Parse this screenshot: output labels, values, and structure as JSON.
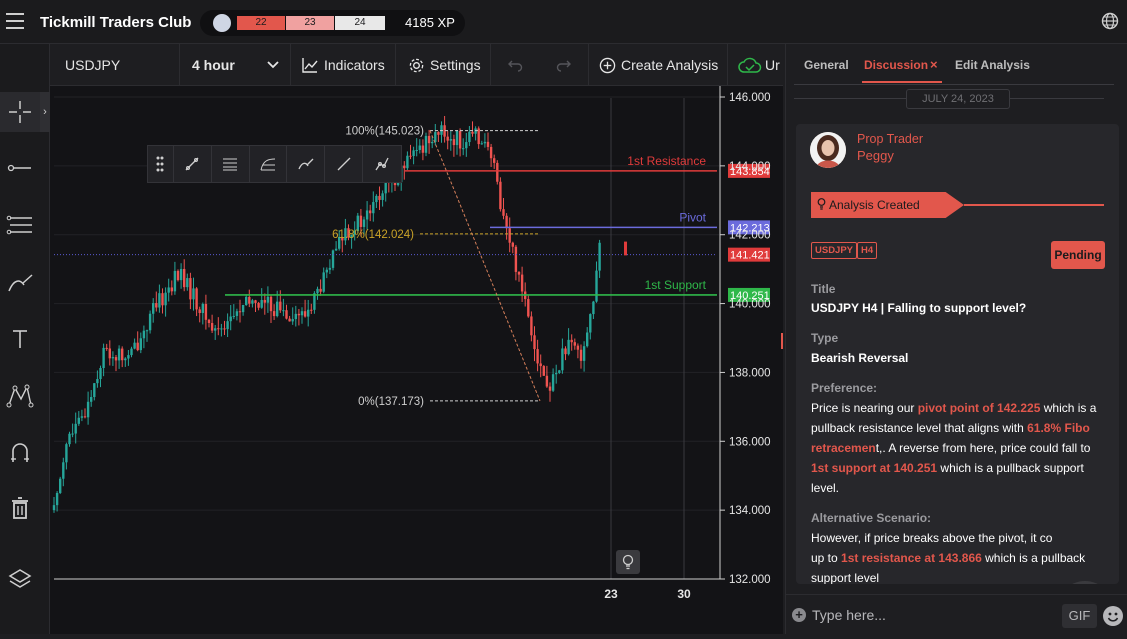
{
  "app": {
    "title": "Tickmill Traders Club"
  },
  "xp": {
    "seg1": "22",
    "seg2": "23",
    "seg3": "24",
    "total": "4185 XP"
  },
  "toolbar": {
    "symbol": "USDJPY",
    "timeframe": "4 hour",
    "indicators": "Indicators",
    "settings": "Settings",
    "create_analysis": "Create Analysis",
    "cut_label": "Ur"
  },
  "chart_data": {
    "type": "candlestick",
    "symbol": "USDJPY",
    "timeframe": "4 hour",
    "ylim": [
      132.0,
      146.0
    ],
    "y_ticks": [
      "146.000",
      "144.000",
      "142.000",
      "140.000",
      "138.000",
      "136.000",
      "134.000",
      "132.000"
    ],
    "x_ticks": [
      "23",
      "30"
    ],
    "levels": [
      {
        "name": "1st Resistance",
        "value": 143.854,
        "label": "143.854",
        "color": "#e03b3b"
      },
      {
        "name": "Pivot",
        "value": 142.213,
        "label": "142.213",
        "color": "#6b6bdc"
      },
      {
        "name": "1st Support",
        "value": 140.251,
        "label": "140.251",
        "color": "#2fb84a"
      }
    ],
    "current_price": {
      "value": 141.421,
      "label": "141.421",
      "color": "#e03b3b"
    },
    "fibonacci": [
      {
        "label": "100%(145.023)",
        "value": 145.023
      },
      {
        "label": "61.8%(142.024)",
        "value": 142.024
      },
      {
        "label": "0%(137.173)",
        "value": 137.173
      }
    ],
    "colors": {
      "up": "#26a69a",
      "down": "#ef5350"
    }
  },
  "panel": {
    "tabs": [
      {
        "label": "General"
      },
      {
        "label": "Discussion"
      },
      {
        "label": "Edit Analysis"
      }
    ],
    "close_symbol": "×",
    "date": "JULY 24, 2023",
    "author_role": "Prop Trader",
    "author_name": "Peggy",
    "banner": "Analysis Created",
    "tags": [
      "USDJPY",
      "H4"
    ],
    "status": "Pending",
    "title_label": "Title",
    "title": "USDJPY H4 | Falling to support level?",
    "type_label": "Type",
    "type": "Bearish Reversal",
    "preference_label": "Preference:",
    "preference": {
      "p1": "Price is nearing our ",
      "h1": "pivot point of 142.225",
      "p2": " which is a pullback resistance level that aligns with ",
      "h2": "61.8% Fibo retracemen",
      "p3": "t,. A reverse from here, price could fall to ",
      "h3": "1st support at 140.251",
      "p4": " which is a pullback support level."
    },
    "alt_label": "Alternative Scenario:",
    "alt": {
      "p1": "However, if price breaks above the pivot, it co",
      "p2": "up to ",
      "h1": "1st resistance at 143.866",
      "p3": " which is a pullback",
      "p4": "support level"
    },
    "input_placeholder": "Type here...",
    "gif": "GIF"
  }
}
